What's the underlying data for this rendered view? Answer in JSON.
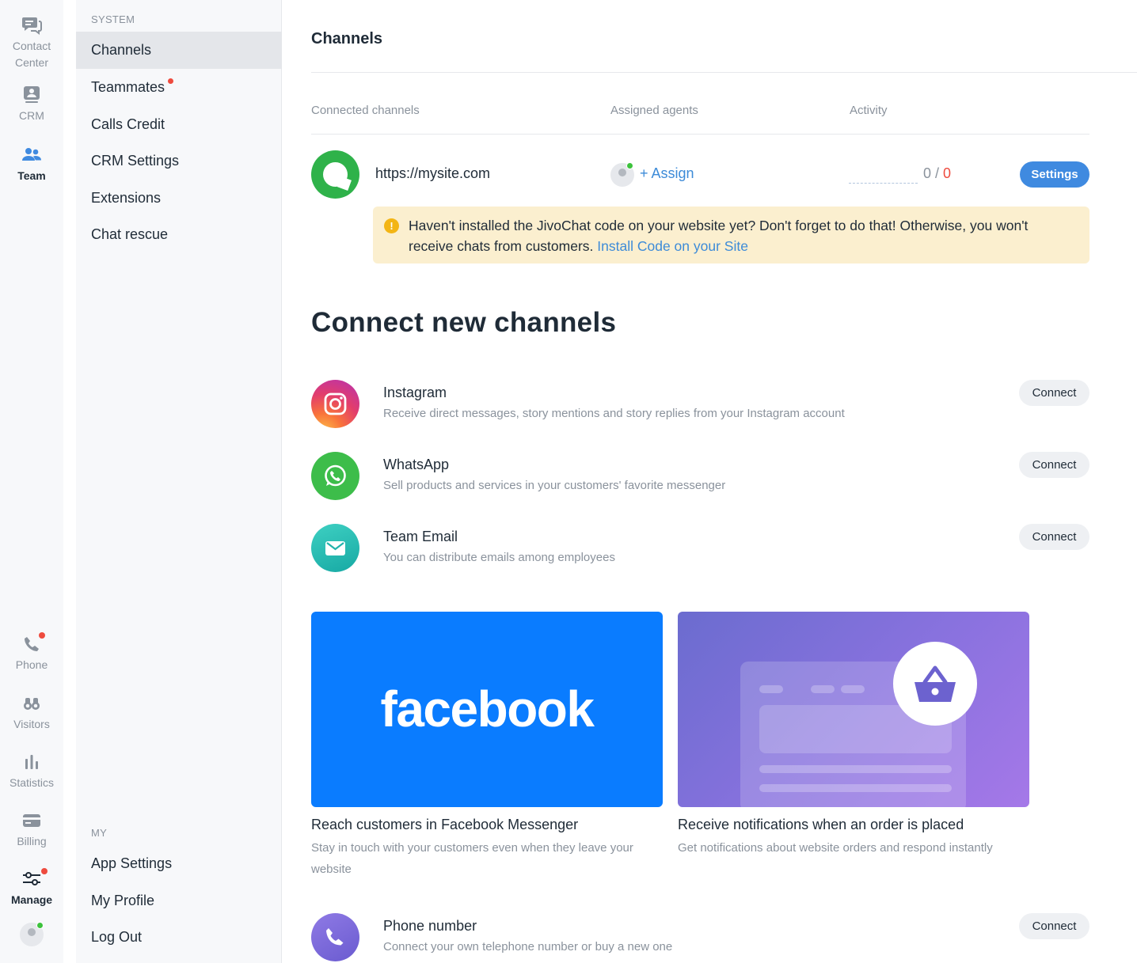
{
  "rail": {
    "top": [
      {
        "label_lines": [
          "Contact",
          "Center"
        ],
        "icon": "chat-bubbles-icon",
        "active": false
      },
      {
        "label": "CRM",
        "icon": "crm-card-icon",
        "active": false
      },
      {
        "label": "Team",
        "icon": "team-icon",
        "active": true
      }
    ],
    "bottom": [
      {
        "label": "Phone",
        "icon": "phone-icon",
        "badge": true
      },
      {
        "label": "Visitors",
        "icon": "binoculars-icon"
      },
      {
        "label": "Statistics",
        "icon": "bar-chart-icon"
      },
      {
        "label": "Billing",
        "icon": "credit-card-icon"
      },
      {
        "label": "Manage",
        "icon": "sliders-icon",
        "badge": true,
        "active": true
      }
    ]
  },
  "sidebar": {
    "system_title": "SYSTEM",
    "items": [
      {
        "label": "Channels",
        "active": true
      },
      {
        "label": "Teammates",
        "badge": true
      },
      {
        "label": "Calls Credit"
      },
      {
        "label": "CRM Settings"
      },
      {
        "label": "Extensions"
      },
      {
        "label": "Chat rescue"
      }
    ],
    "my_title": "MY",
    "my_items": [
      {
        "label": "App Settings"
      },
      {
        "label": "My Profile"
      },
      {
        "label": "Log Out"
      }
    ]
  },
  "main": {
    "title": "Channels",
    "columns": [
      "Connected channels",
      "Assigned agents",
      "Activity"
    ],
    "connected": {
      "url": "https://mysite.com",
      "assign_label": "+ Assign",
      "activity_a": "0",
      "activity_sep": " / ",
      "activity_b": "0",
      "settings_label": "Settings"
    },
    "warning": {
      "icon": "exclamation-icon",
      "text": "Haven't installed the JivoChat code on your website yet? Don't forget to do that! Otherwise, you won't receive chats from customers. ",
      "link": "Install Code on your Site"
    },
    "connect_title": "Connect new channels",
    "channels": [
      {
        "name": "Instagram",
        "desc": "Receive direct messages, story mentions and story replies from your Instagram account",
        "button": "Connect",
        "icon": "instagram-icon"
      },
      {
        "name": "WhatsApp",
        "desc": "Sell products and services in your customers' favorite messenger",
        "button": "Connect",
        "icon": "whatsapp-icon"
      },
      {
        "name": "Team Email",
        "desc": "You can distribute emails among employees",
        "button": "Connect",
        "icon": "envelope-icon"
      }
    ],
    "cards": [
      {
        "word": "facebook",
        "title": "Reach customers in Facebook Messenger",
        "desc": "Stay in touch with your customers even when they leave your website"
      },
      {
        "title": "Receive notifications when an order is placed",
        "desc": "Get notifications about website orders and respond instantly",
        "icon": "basket-icon"
      }
    ],
    "phone_channel": {
      "name": "Phone number",
      "desc": "Connect your own telephone number or buy a new one",
      "button": "Connect",
      "icon": "phone-icon"
    }
  },
  "colors": {
    "accent": "#3f8ae0",
    "link": "#3d8bd8",
    "badge": "#ee4b3e",
    "warning_bg": "#fbefcf",
    "facebook": "#0a7cff"
  }
}
